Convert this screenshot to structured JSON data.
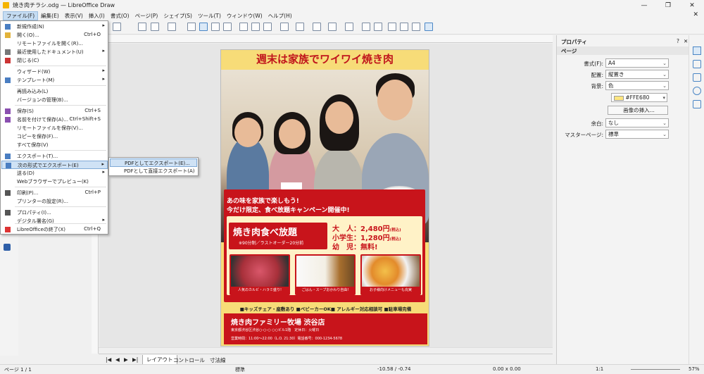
{
  "window": {
    "title": "焼き肉チラシ.odg — LibreOffice Draw",
    "min": "—",
    "max": "❐",
    "close": "✕"
  },
  "menubar": [
    "ファイル(F)",
    "編集(E)",
    "表示(V)",
    "挿入(I)",
    "書式(O)",
    "ページ(P)",
    "シェイプ(S)",
    "ツール(T)",
    "ウィンドウ(W)",
    "ヘルプ(H)"
  ],
  "file_menu": [
    {
      "label": "新規作成(N)",
      "shortcut": "",
      "arrow": "▸",
      "icon": "new-doc-icon",
      "color": "#4a7ec2"
    },
    {
      "label": "開く(O)...",
      "shortcut": "Ctrl+O",
      "arrow": "",
      "icon": "folder-icon",
      "color": "#e2b33b"
    },
    {
      "label": "リモートファイルを開く(R)...",
      "shortcut": "",
      "arrow": "",
      "icon": "",
      "color": ""
    },
    {
      "label": "最近使用したドキュメント(U)",
      "shortcut": "",
      "arrow": "▸",
      "icon": "clock-icon",
      "color": "#777"
    },
    {
      "label": "閉じる(C)",
      "shortcut": "",
      "arrow": "",
      "icon": "close-doc-icon",
      "color": "#c33"
    },
    {
      "label": "ウィザード(W)",
      "shortcut": "",
      "arrow": "▸",
      "icon": "",
      "color": ""
    },
    {
      "label": "テンプレート(M)",
      "shortcut": "",
      "arrow": "▸",
      "icon": "template-icon",
      "color": "#4a7ec2"
    },
    {
      "label": "再読み込み(L)",
      "shortcut": "",
      "arrow": "",
      "icon": "",
      "color": ""
    },
    {
      "label": "バージョンの管理(B)...",
      "shortcut": "",
      "arrow": "",
      "icon": "",
      "color": ""
    },
    {
      "label": "保存(S)",
      "shortcut": "Ctrl+S",
      "arrow": "",
      "icon": "save-icon",
      "color": "#8a4fb0"
    },
    {
      "label": "名前を付けて保存(A)...",
      "shortcut": "Ctrl+Shift+S",
      "arrow": "",
      "icon": "save-as-icon",
      "color": "#8a4fb0"
    },
    {
      "label": "リモートファイルを保存(V)...",
      "shortcut": "",
      "arrow": "",
      "icon": "",
      "color": ""
    },
    {
      "label": "コピーを保存(F)...",
      "shortcut": "",
      "arrow": "",
      "icon": "",
      "color": ""
    },
    {
      "label": "すべて保存(V)",
      "shortcut": "",
      "arrow": "",
      "icon": "",
      "color": ""
    },
    {
      "label": "エクスポート(T)...",
      "shortcut": "",
      "arrow": "",
      "icon": "export-icon",
      "color": "#4a7ec2"
    },
    {
      "label": "次の形式でエクスポート(E)",
      "shortcut": "",
      "arrow": "▸",
      "icon": "export-as-icon",
      "color": "#4a7ec2"
    },
    {
      "label": "送る(D)",
      "shortcut": "",
      "arrow": "▸",
      "icon": "",
      "color": ""
    },
    {
      "label": "Webブラウザーでプレビュー(K)",
      "shortcut": "",
      "arrow": "",
      "icon": "",
      "color": ""
    },
    {
      "label": "印刷(P)...",
      "shortcut": "Ctrl+P",
      "arrow": "",
      "icon": "print-icon",
      "color": "#555"
    },
    {
      "label": "プリンターの設定(R)...",
      "shortcut": "",
      "arrow": "",
      "icon": "",
      "color": ""
    },
    {
      "label": "プロパティ(I)...",
      "shortcut": "",
      "arrow": "",
      "icon": "properties-icon",
      "color": "#555"
    },
    {
      "label": "デジタル署名(G)",
      "shortcut": "",
      "arrow": "▸",
      "icon": "",
      "color": ""
    },
    {
      "label": "LibreOfficeの終了(X)",
      "shortcut": "Ctrl+Q",
      "arrow": "",
      "icon": "exit-icon",
      "color": "#d33"
    }
  ],
  "export_submenu": [
    "PDFとしてエクスポート(E)...",
    "PDFとして直接エクスポート(A)"
  ],
  "flyer": {
    "title": "週末は家族でワイワイ焼き肉",
    "promo1": "あの味を家族で楽しもう!",
    "promo2": "今だけ限定、食べ放題キャンペーン開催中!",
    "plan": "焼き肉食べ放題",
    "plan_note": "※90分制／ラストオーダー20分前",
    "prices": [
      {
        "label": "大　人：2,480円",
        "tax": "(税込)"
      },
      {
        "label": "小学生：1,280円",
        "tax": "(税込)"
      },
      {
        "label": "幼　児：無料!",
        "tax": ""
      }
    ],
    "foods": [
      "人気のカルビ・ハラミ盛り!",
      "ごはん・スープおかわり自由!",
      "お子様向けメニューも充実"
    ],
    "features": "■キッズチェア・座敷あり ■ベビーカーOK■ アレルギー対応相談可 ■駐車場完備",
    "store": "焼き肉ファミリー牧場 渋谷店",
    "address": "東京都渋谷区渋谷○-○-○ ○○ビル1階　定休日：火曜日",
    "hours": "営業時間：11:00～22:00（L.O. 21:30）電話番号：000-1234-5678"
  },
  "sidebar": {
    "title": "プロパティ",
    "help": "?",
    "close": "✕",
    "menu": "≡",
    "section": "ページ",
    "rows": [
      {
        "key": "書式(F):",
        "value": "A4"
      },
      {
        "key": "配置:",
        "value": "縦置き"
      },
      {
        "key": "背景:",
        "value": "色"
      }
    ],
    "color_value": "#FFE680",
    "insert_image": "画像の挿入...",
    "rows2": [
      {
        "key": "余白:",
        "value": "なし"
      },
      {
        "key": "マスターページ:",
        "value": "標準"
      }
    ]
  },
  "tabs": [
    "レイアウト",
    "コントロール",
    "寸法線"
  ],
  "status": {
    "page": "ページ 1 / 1",
    "style": "標準",
    "pos": "-10.58 / -0.74",
    "size": "0.00 x 0.00",
    "ratio": "1:1",
    "zoom": "57%"
  },
  "colors": {
    "accent": "#c8141b",
    "flyer_bg": "#f7dc78",
    "highlight": "#cfe2f5"
  }
}
